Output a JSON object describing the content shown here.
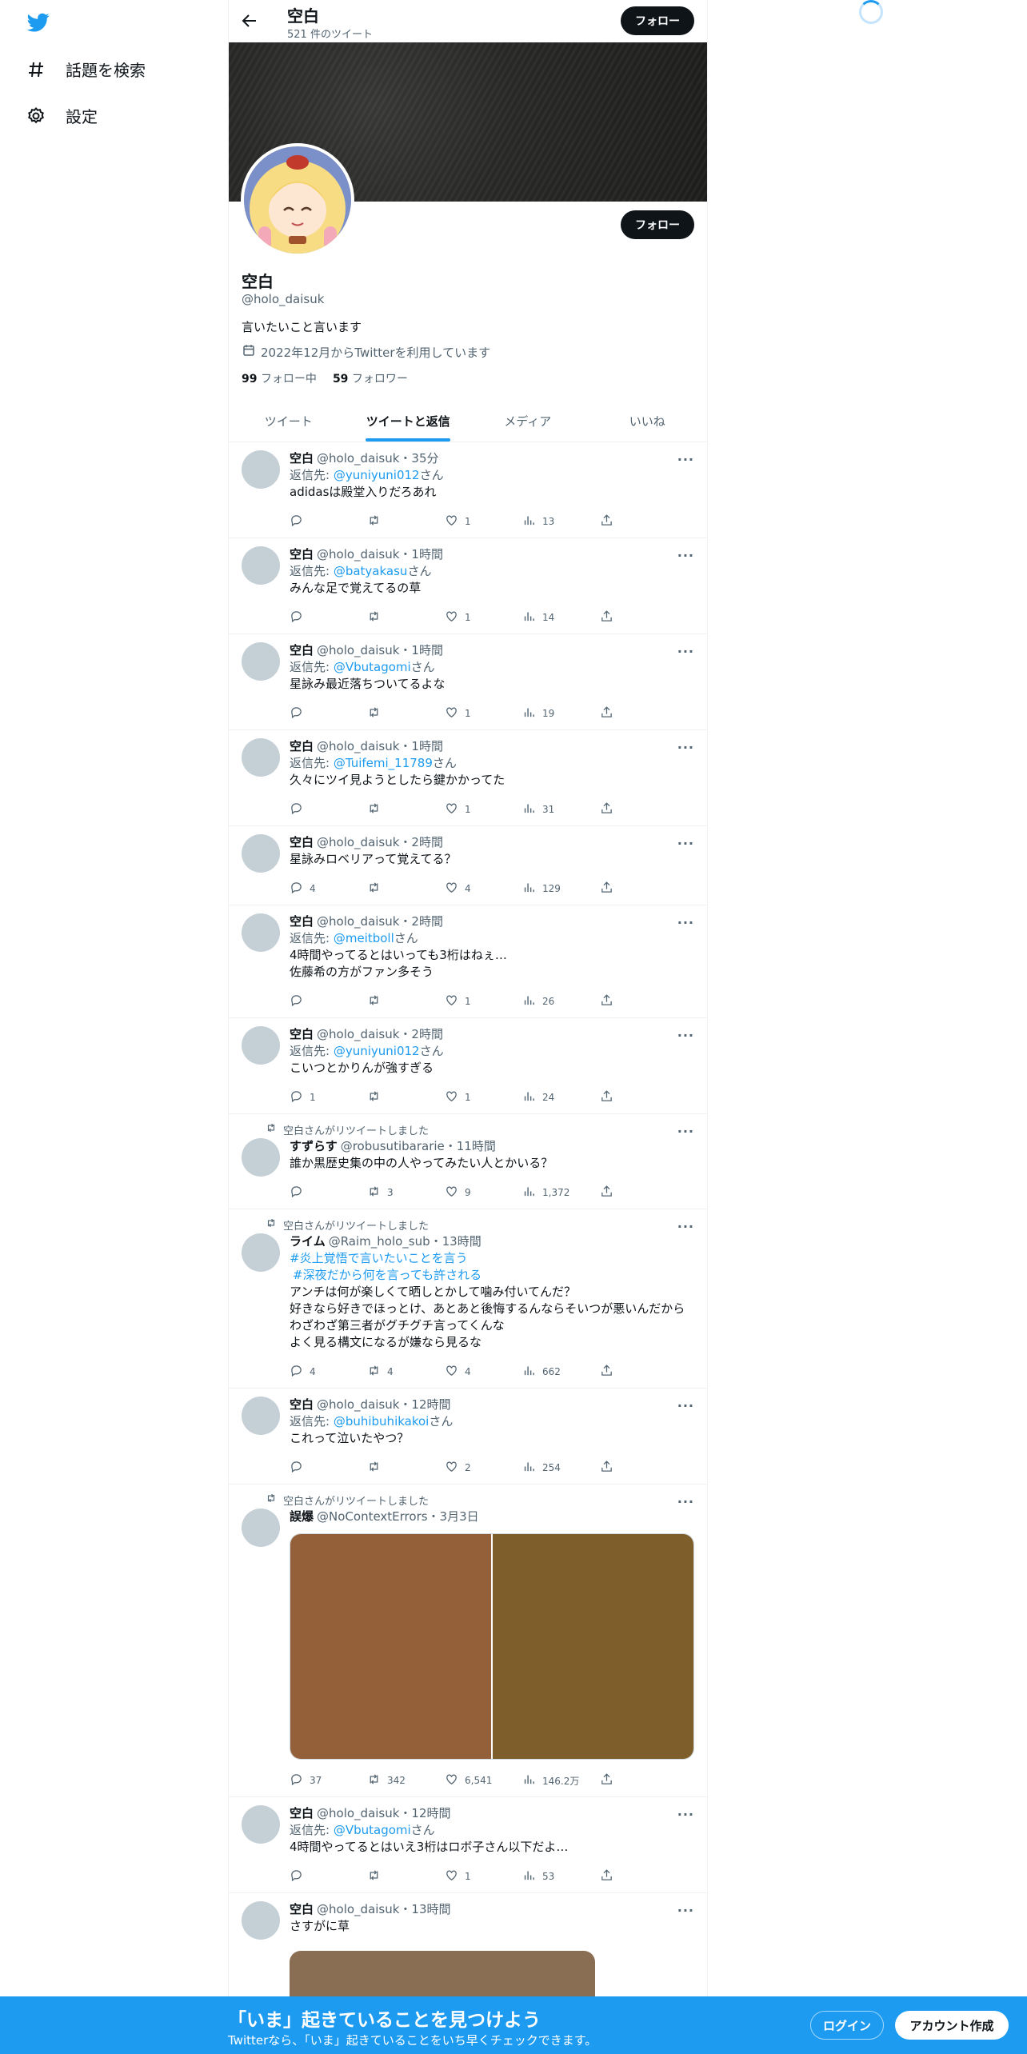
{
  "nav": {
    "logo": "twitter-bird-icon",
    "explore": "話題を検索",
    "settings": "設定"
  },
  "header": {
    "name": "空白",
    "tweet_count": "521 件のツイート",
    "follow": "フォロー"
  },
  "profile": {
    "name": "空白",
    "handle": "@holo_daisuk",
    "bio": "言いたいこと言います",
    "joined": "2022年12月からTwitterを利用しています",
    "following_count": "99",
    "following_label": "フォロー中",
    "followers_count": "59",
    "followers_label": "フォロワー",
    "follow": "フォロー"
  },
  "tabs": [
    "ツイート",
    "ツイートと返信",
    "メディア",
    "いいね"
  ],
  "reply_prefix": "返信先: ",
  "reply_suffix": "さん",
  "tweets": [
    {
      "name": "空白",
      "meta": "@holo_daisuk・35分",
      "reply_to": "@yuniyuni012",
      "text": "adidasは殿堂入りだろあれ",
      "replies": "",
      "retweets": "",
      "likes": "1",
      "views": "13"
    },
    {
      "name": "空白",
      "meta": "@holo_daisuk・1時間",
      "reply_to": "@batyakasu",
      "text": "みんな足で覚えてるの草",
      "replies": "",
      "retweets": "",
      "likes": "1",
      "views": "14"
    },
    {
      "name": "空白",
      "meta": "@holo_daisuk・1時間",
      "reply_to": "@Vbutagomi",
      "text": "星詠み最近落ちついてるよな",
      "replies": "",
      "retweets": "",
      "likes": "1",
      "views": "19"
    },
    {
      "name": "空白",
      "meta": "@holo_daisuk・1時間",
      "reply_to": "@Tuifemi_11789",
      "text": "久々にツイ見ようとしたら鍵かかってた",
      "replies": "",
      "retweets": "",
      "likes": "1",
      "views": "31"
    },
    {
      "name": "空白",
      "meta": "@holo_daisuk・2時間",
      "reply_to": "",
      "text": "星詠みロベリアって覚えてる？",
      "replies": "4",
      "retweets": "",
      "likes": "4",
      "views": "129"
    },
    {
      "name": "空白",
      "meta": "@holo_daisuk・2時間",
      "reply_to": "@meitboll",
      "text": "4時間やってるとはいっても3桁はねぇ…\n佐藤希の方がファン多そう",
      "replies": "",
      "retweets": "",
      "likes": "1",
      "views": "26"
    },
    {
      "name": "空白",
      "meta": "@holo_daisuk・2時間",
      "reply_to": "@yuniyuni012",
      "text": "こいつとかりんが強すぎる",
      "replies": "1",
      "retweets": "",
      "likes": "1",
      "views": "24"
    },
    {
      "retweeted_by": "空白さんがリツイートしました",
      "name": "すずらす",
      "meta": "@robusutibararie・11時間",
      "reply_to": "",
      "text": "誰か黒歴史集の中の人やってみたい人とかいる？",
      "replies": "",
      "retweets": "3",
      "likes": "9",
      "views": "1,372"
    },
    {
      "retweeted_by": "空白さんがリツイートしました",
      "name": "ライム",
      "meta": "@Raim_holo_sub・13時間",
      "reply_to": "",
      "hashtags": [
        "#炎上覚悟で言いたいことを言う",
        "#深夜だから何を言っても許される"
      ],
      "text": "アンチは何が楽しくて晒しとかして噛み付いてんだ？\n好きなら好きでほっとけ、あとあと後悔するんならそいつが悪いんだから\nわざわざ第三者がグチグチ言ってくんな\nよく見る構文になるが嫌なら見るな",
      "replies": "4",
      "retweets": "4",
      "likes": "4",
      "views": "662"
    },
    {
      "name": "空白",
      "meta": "@holo_daisuk・12時間",
      "reply_to": "@buhibuhikakoi",
      "text": "これって泣いたやつ？",
      "replies": "",
      "retweets": "",
      "likes": "2",
      "views": "254"
    },
    {
      "retweeted_by": "空白さんがリツイートしました",
      "name": "誤爆",
      "meta": "@NoContextErrors・3月3日",
      "reply_to": "",
      "text": "",
      "media_colors": [
        "#93603a",
        "#7e5e2a"
      ],
      "replies": "37",
      "retweets": "342",
      "likes": "6,541",
      "views": "146.2万"
    },
    {
      "name": "空白",
      "meta": "@holo_daisuk・12時間",
      "reply_to": "@Vbutagomi",
      "text": "4時間やってるとはいえ3桁はロボ子さん以下だよ…",
      "replies": "",
      "retweets": "",
      "likes": "1",
      "views": "53"
    },
    {
      "name": "空白",
      "meta": "@holo_daisuk・13時間",
      "reply_to": "",
      "text": "さすがに草",
      "media_single": "#8a6e54",
      "replies": "",
      "retweets": "",
      "likes": "",
      "views": ""
    }
  ],
  "bottom": {
    "title": "「いま」起きていることを見つけよう",
    "subtitle": "Twitterなら、「いま」起きていることをいち早くチェックできます。",
    "login": "ログイン",
    "signup": "アカウント作成"
  },
  "colors": {
    "accent": "#1d9bf0",
    "dark": "#0f1419",
    "muted": "#536471"
  }
}
